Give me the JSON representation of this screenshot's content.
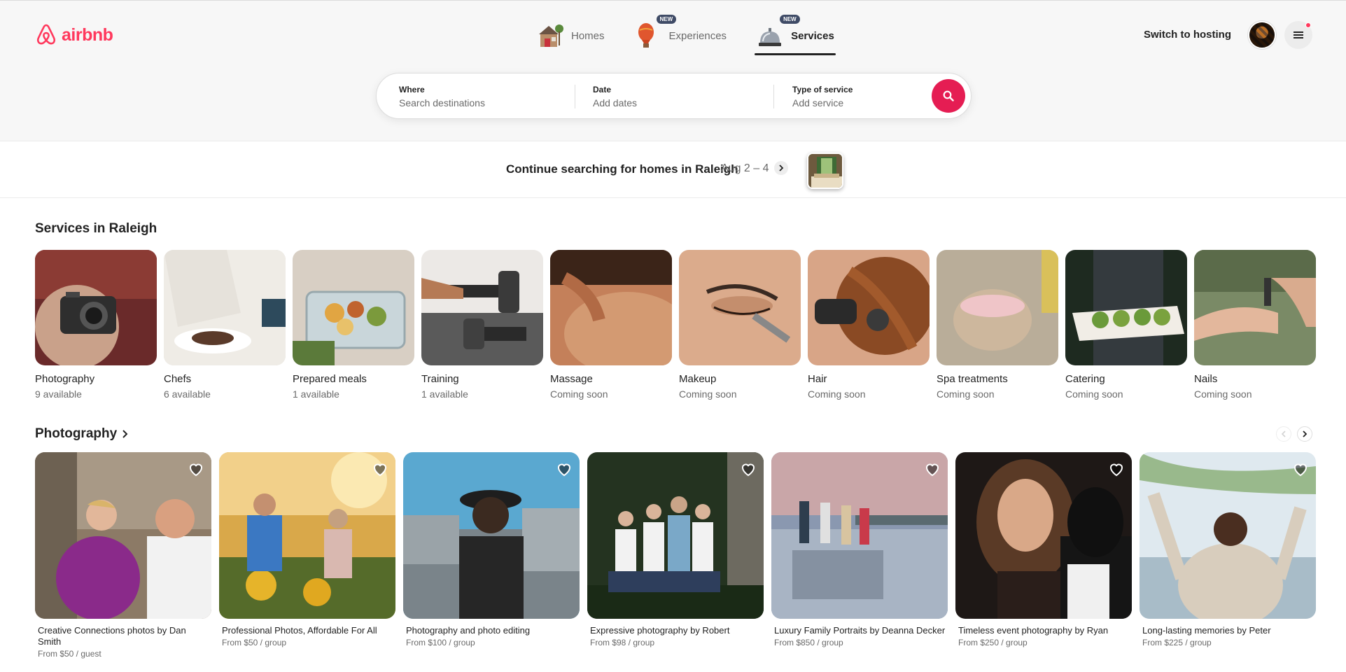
{
  "brand": {
    "name": "airbnb",
    "color": "#ff385c"
  },
  "nav": {
    "homes": {
      "label": "Homes",
      "icon": "house-icon"
    },
    "experiences": {
      "label": "Experiences",
      "badge": "NEW",
      "icon": "hot-air-balloon-icon"
    },
    "services": {
      "label": "Services",
      "badge": "NEW",
      "icon": "service-bell-icon"
    }
  },
  "header": {
    "host_link": "Switch to hosting"
  },
  "search": {
    "where": {
      "label": "Where",
      "placeholder": "Search destinations"
    },
    "date": {
      "label": "Date",
      "placeholder": "Add dates"
    },
    "type": {
      "label": "Type of service",
      "placeholder": "Add service"
    }
  },
  "continue": {
    "text": "Continue searching for homes in Raleigh",
    "dates": "Aug 2 – 4"
  },
  "services_section": {
    "title": "Services in Raleigh",
    "items": [
      {
        "name": "Photography",
        "availability": "9 available"
      },
      {
        "name": "Chefs",
        "availability": "6 available"
      },
      {
        "name": "Prepared meals",
        "availability": "1 available"
      },
      {
        "name": "Training",
        "availability": "1 available"
      },
      {
        "name": "Massage",
        "availability": "Coming soon"
      },
      {
        "name": "Makeup",
        "availability": "Coming soon"
      },
      {
        "name": "Hair",
        "availability": "Coming soon"
      },
      {
        "name": "Spa treatments",
        "availability": "Coming soon"
      },
      {
        "name": "Catering",
        "availability": "Coming soon"
      },
      {
        "name": "Nails",
        "availability": "Coming soon"
      }
    ]
  },
  "photography_section": {
    "title": "Photography",
    "listings": [
      {
        "title": "Creative Connections photos by Dan Smith",
        "price": "From $50 / guest"
      },
      {
        "title": "Professional Photos, Affordable For All",
        "price": "From $50 / group"
      },
      {
        "title": "Photography and photo editing",
        "price": "From $100 / group"
      },
      {
        "title": "Expressive photography by Robert",
        "price": "From $98 / group"
      },
      {
        "title": "Luxury Family Portraits by Deanna Decker",
        "price": "From $850 / group"
      },
      {
        "title": "Timeless event photography by Ryan",
        "price": "From $250 / group"
      },
      {
        "title": "Long-lasting memories by Peter",
        "price": "From $225 / group"
      }
    ]
  }
}
